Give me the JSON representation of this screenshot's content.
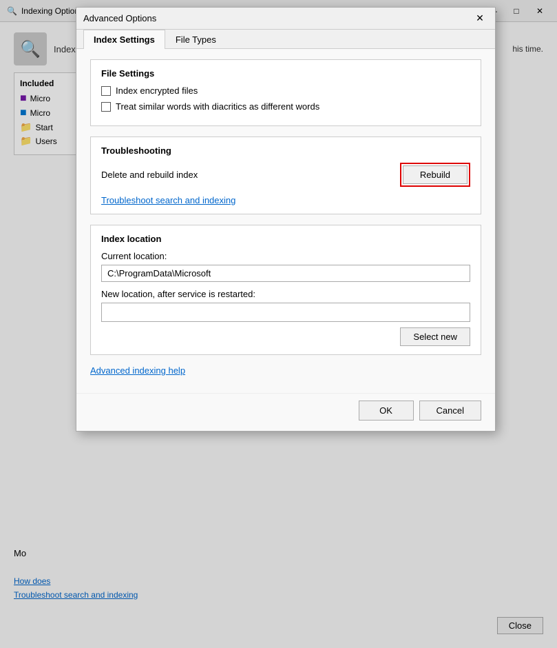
{
  "bgWindow": {
    "title": "Indexing Options",
    "titleIcon": "🔍",
    "closeBtn": "✕",
    "minimizeBtn": "—",
    "maximizeBtn": "□",
    "description": "Index the",
    "rightText": "his time.",
    "included": {
      "title": "Included",
      "items": [
        {
          "label": "Micro",
          "icon": "onenote"
        },
        {
          "label": "Micro",
          "icon": "outlook"
        },
        {
          "label": "Start",
          "icon": "folder"
        },
        {
          "label": "Users",
          "icon": "folder"
        }
      ]
    },
    "modifyBtn": "Mo",
    "links": [
      "How does",
      "Troubleshoot search and indexing"
    ],
    "closeButton": "Close"
  },
  "dialog": {
    "title": "Advanced Options",
    "closeBtn": "✕",
    "tabs": [
      {
        "id": "index-settings",
        "label": "Index Settings",
        "active": true
      },
      {
        "id": "file-types",
        "label": "File Types",
        "active": false
      }
    ],
    "fileSettings": {
      "sectionLabel": "File Settings",
      "checkboxes": [
        {
          "id": "encrypt",
          "label": "Index encrypted files",
          "checked": false
        },
        {
          "id": "diacritics",
          "label": "Treat similar words with diacritics as different words",
          "checked": false
        }
      ]
    },
    "troubleshooting": {
      "sectionLabel": "Troubleshooting",
      "deleteLabel": "Delete and rebuild index",
      "rebuildBtn": "Rebuild",
      "link": "Troubleshoot search and indexing"
    },
    "indexLocation": {
      "sectionLabel": "Index location",
      "currentLocationLabel": "Current location:",
      "currentLocationValue": "C:\\ProgramData\\Microsoft",
      "newLocationLabel": "New location, after service is restarted:",
      "newLocationValue": "",
      "selectNewBtn": "Select new"
    },
    "advancedHelpLink": "Advanced indexing help",
    "footer": {
      "okBtn": "OK",
      "cancelBtn": "Cancel"
    }
  }
}
